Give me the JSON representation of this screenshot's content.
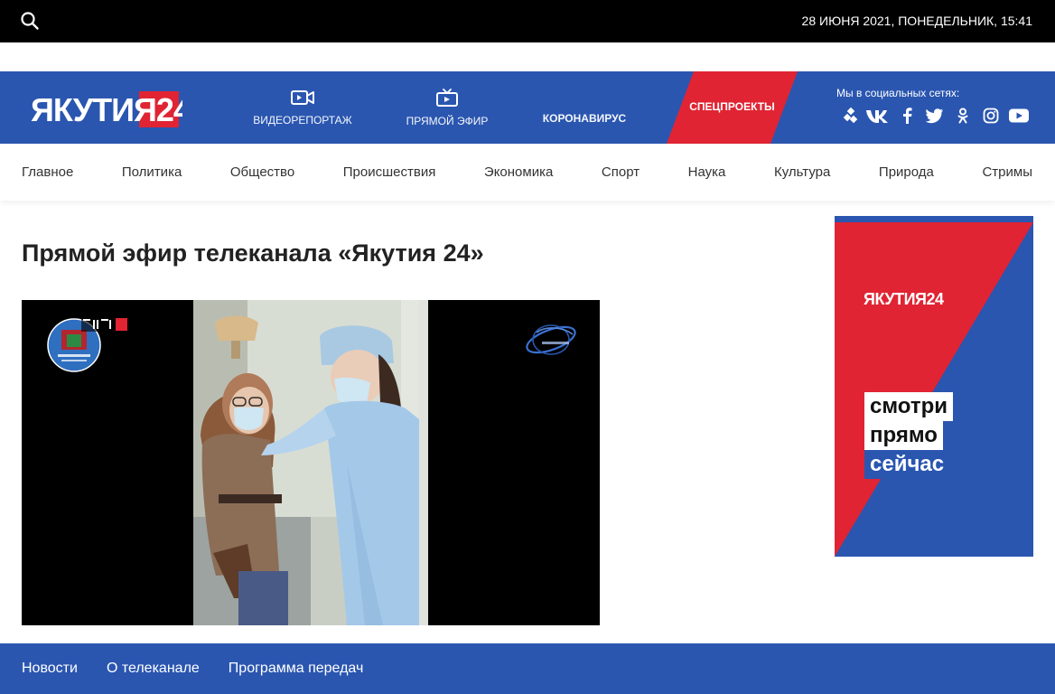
{
  "topbar": {
    "search_icon": "search-icon",
    "datetime": "28 ИЮНЯ 2021, ПОНЕДЕЛЬНИК, 15:41"
  },
  "header": {
    "logo_text": "ЯКУТИЯ24",
    "nav": [
      {
        "label": "ВИДЕОРЕПОРТАЖ",
        "icon": "video-camera-icon"
      },
      {
        "label": "ПРЯМОЙ ЭФИР",
        "icon": "tv-icon"
      },
      {
        "label": "КОРОНАВИРУС"
      }
    ],
    "special_label": "СПЕЦПРОЕКТЫ",
    "social_title": "Мы в социальных сетях:",
    "social_icons": [
      "telegram-icon",
      "vk-icon",
      "facebook-icon",
      "twitter-icon",
      "odnoklassniki-icon",
      "instagram-icon",
      "youtube-icon"
    ]
  },
  "categories": [
    "Главное",
    "Политика",
    "Общество",
    "Происшествия",
    "Экономика",
    "Спорт",
    "Наука",
    "Культура",
    "Природа",
    "Стримы"
  ],
  "main": {
    "title": "Прямой эфир телеканала «Якутия 24»"
  },
  "banner": {
    "logo": "ЯКУТИЯ24",
    "line1": "смотри",
    "line2": "прямо",
    "line3": "сейчас"
  },
  "footer": {
    "links": [
      "Новости",
      "О телеканале",
      "Программа передач"
    ]
  },
  "colors": {
    "brand_blue": "#2a56b0",
    "brand_red": "#e02433"
  }
}
